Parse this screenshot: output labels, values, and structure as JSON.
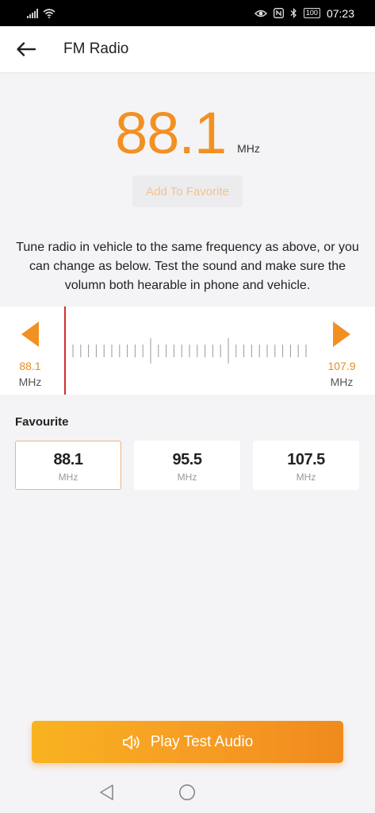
{
  "status_bar": {
    "time": "07:23",
    "battery": "100"
  },
  "header": {
    "title": "FM Radio"
  },
  "tuner": {
    "frequency": "88.1",
    "unit": "MHz",
    "add_favorite_label": "Add To Favorite",
    "description": "Tune radio in vehicle to the same frequency as above, or you can change as below. Test the sound and make sure the volumn both hearable in phone and vehicle.",
    "min": "88.1",
    "max": "107.9",
    "min_unit": "MHz",
    "max_unit": "MHz"
  },
  "favourites": {
    "title": "Favourite",
    "items": [
      {
        "value": "88.1",
        "unit": "MHz"
      },
      {
        "value": "95.5",
        "unit": "MHz"
      },
      {
        "value": "107.5",
        "unit": "MHz"
      }
    ]
  },
  "play_button": {
    "label": "Play Test Audio"
  },
  "colors": {
    "accent": "#f29022",
    "indicator": "#d32f2f",
    "button_gradient_start": "#f8b320",
    "button_gradient_end": "#f08a1d"
  }
}
